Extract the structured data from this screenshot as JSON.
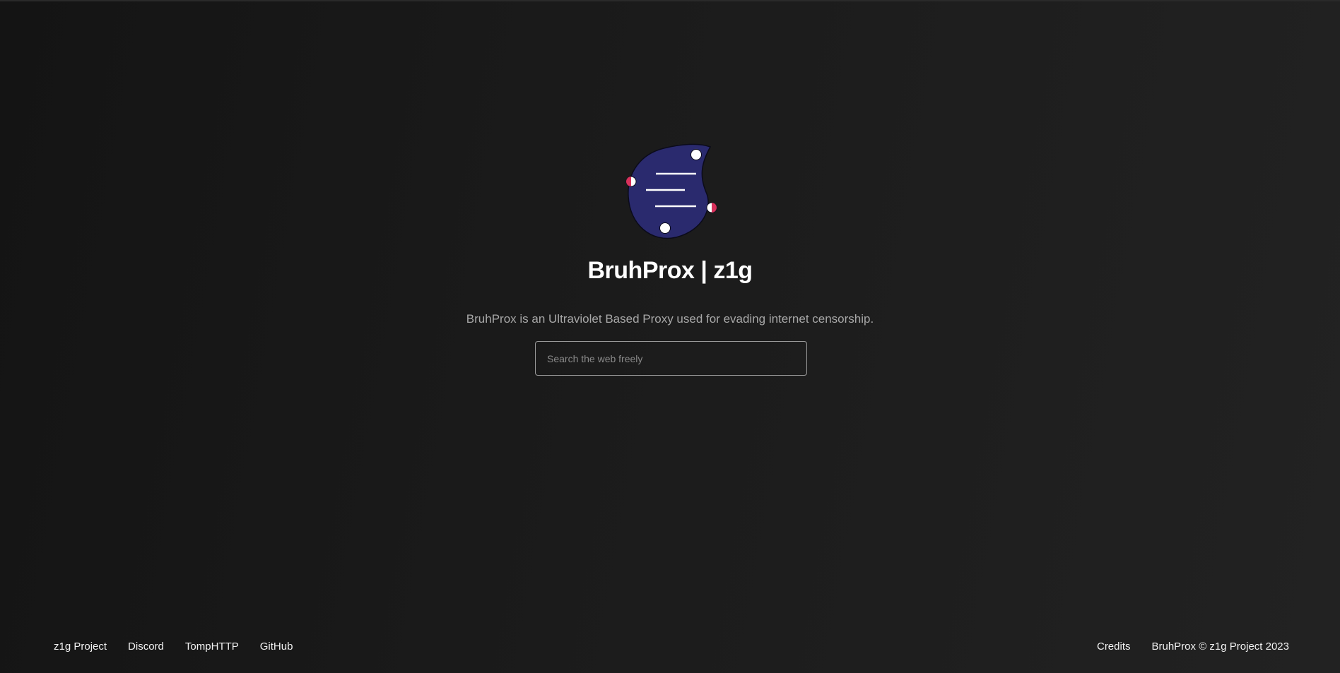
{
  "hero": {
    "title": "BruhProx | z1g",
    "description": "BruhProx is an Ultraviolet Based Proxy used for evading internet censorship."
  },
  "search": {
    "placeholder": "Search the web freely",
    "value": ""
  },
  "footer": {
    "left_links": [
      "z1g Project",
      "Discord",
      "TompHTTP",
      "GitHub"
    ],
    "credits_label": "Credits",
    "copyright": "BruhProx © z1g Project 2023"
  },
  "colors": {
    "background": "#1d1d1d",
    "logo_fill": "#2a2a6e",
    "logo_accent": "#d8315b",
    "text_muted": "#a8a8a8"
  },
  "icons": {
    "logo": "ultraviolet-blob-logo"
  }
}
